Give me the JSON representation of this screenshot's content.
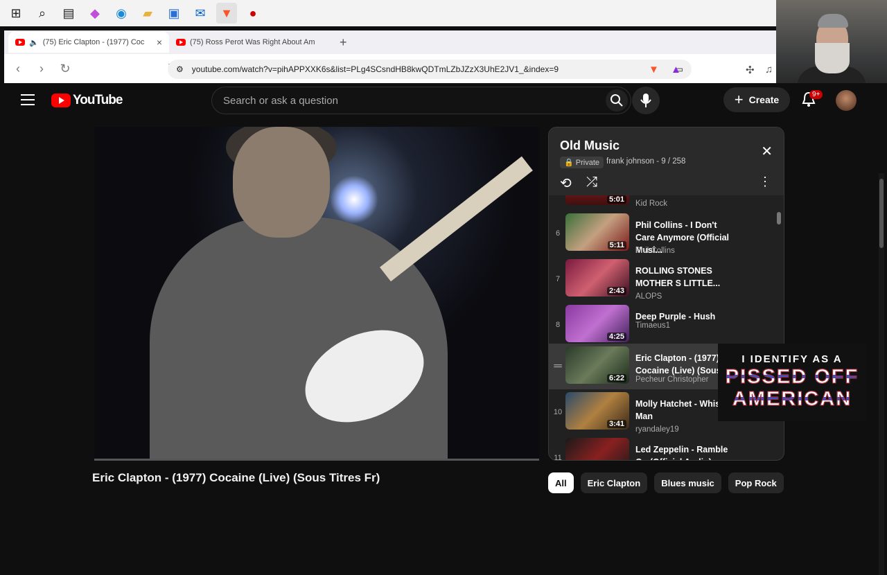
{
  "taskbar": {
    "icons": [
      "windows-icon",
      "search-icon",
      "widgets-icon",
      "copilot-icon",
      "edge-icon",
      "explorer-icon",
      "store-icon",
      "outlook-icon",
      "brave-icon",
      "app-icon"
    ]
  },
  "browser": {
    "tabs": [
      {
        "title": "(75) Eric Clapton - (1977) Coc",
        "active": true
      },
      {
        "title": "(75) Ross Perot Was Right About Am",
        "active": false
      }
    ],
    "url": "youtube.com/watch?v=pihAPPXXK6s&list=PLg4SCsndHB8kwQDTmLZbJZzX3UhE2JV1_&index=9"
  },
  "yt": {
    "logo": "YouTube",
    "search_placeholder": "Search or ask a question",
    "create_label": "Create",
    "notif_badge": "9+"
  },
  "video": {
    "title": "Eric Clapton - (1977) Cocaine (Live) (Sous Titres Fr)"
  },
  "playlist": {
    "title": "Old Music",
    "privacy": "Private",
    "owner": "frank johnson - 9 / 258",
    "items": [
      {
        "num": "",
        "title": "",
        "channel": "Kid Rock",
        "duration": "5:01"
      },
      {
        "num": "6",
        "title": "Phil Collins - I Don't Care Anymore (Official Musi...",
        "channel": "Phil Collins",
        "duration": "5:11"
      },
      {
        "num": "7",
        "title": "ROLLING STONES MOTHER S LITTLE...",
        "channel": "ALOPS",
        "duration": "2:43"
      },
      {
        "num": "8",
        "title": "Deep Purple - Hush",
        "channel": "Timaeus1",
        "duration": "4:25"
      },
      {
        "num": "",
        "title": "Eric Clapton - (1977) Cocaine (Live) (Sous",
        "channel": "Pecheur Christopher",
        "duration": "6:22"
      },
      {
        "num": "10",
        "title": "Molly Hatchet - Whis Man",
        "channel": "ryandaley19",
        "duration": "3:41"
      },
      {
        "num": "11",
        "title": "Led Zeppelin - Ramble On (Official Audio)",
        "channel": "",
        "duration": ""
      }
    ]
  },
  "overlay": {
    "line1": "I IDENTIFY AS A",
    "line2": "PISSED OFF",
    "line3": "AMERICAN"
  },
  "chips": [
    "All",
    "Eric Clapton",
    "Blues music",
    "Pop Rock"
  ]
}
